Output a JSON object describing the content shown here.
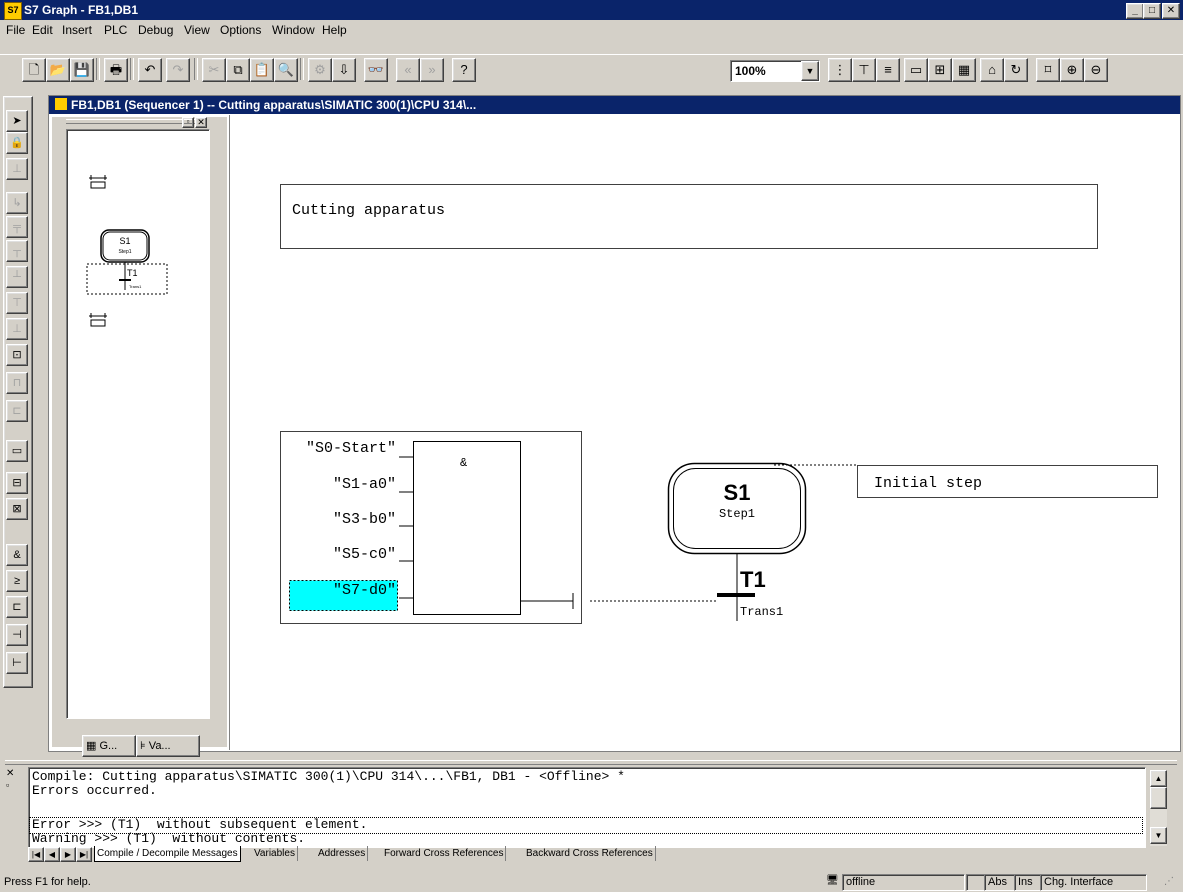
{
  "window": {
    "title": "S7 Graph - FB1,DB1",
    "controls": [
      "_",
      "□",
      "✕"
    ]
  },
  "menu": {
    "items": [
      "File",
      "Edit",
      "Insert",
      "PLC",
      "Debug",
      "View",
      "Options",
      "Window",
      "Help"
    ]
  },
  "toolbar": {
    "zoom": "100%"
  },
  "document": {
    "title": "FB1,DB1 (Sequencer 1) -- Cutting apparatus\\SIMATIC 300(1)\\CPU 314\\..."
  },
  "overview": {
    "step_label": "S1",
    "step_sub": "Step1",
    "trans_label": "T1",
    "trans_sub": "Trans1",
    "tabs": [
      "G...",
      "Va..."
    ]
  },
  "canvas": {
    "comment": "Cutting apparatus",
    "and_symbol": "&",
    "inputs": [
      "\"S0-Start\"",
      "\"S1-a0\"",
      "\"S3-b0\"",
      "\"S5-c0\"",
      "\"S7-d0\""
    ],
    "step": {
      "name": "S1",
      "sub": "Step1",
      "comment": "Initial step"
    },
    "transition": {
      "name": "T1",
      "sub": "Trans1"
    }
  },
  "messages": {
    "lines": [
      "Compile: Cutting apparatus\\SIMATIC 300(1)\\CPU 314\\...\\FB1, DB1 - <Offline> *",
      "Errors occurred.",
      "Error >>> (T1)  without subsequent element.",
      "Warning >>> (T1)  without contents."
    ],
    "tabs": [
      "Compile / Decompile Messages",
      "Variables",
      "Addresses",
      "Forward Cross References",
      "Backward Cross References"
    ]
  },
  "status": {
    "help": "Press F1 for help.",
    "mode": "offline",
    "abs": "Abs",
    "ins": "Ins",
    "chg": "Chg. Interface"
  },
  "colors": {
    "title_bg": "#0a246a",
    "face": "#d4d0c8",
    "highlight": "#00ffff"
  }
}
